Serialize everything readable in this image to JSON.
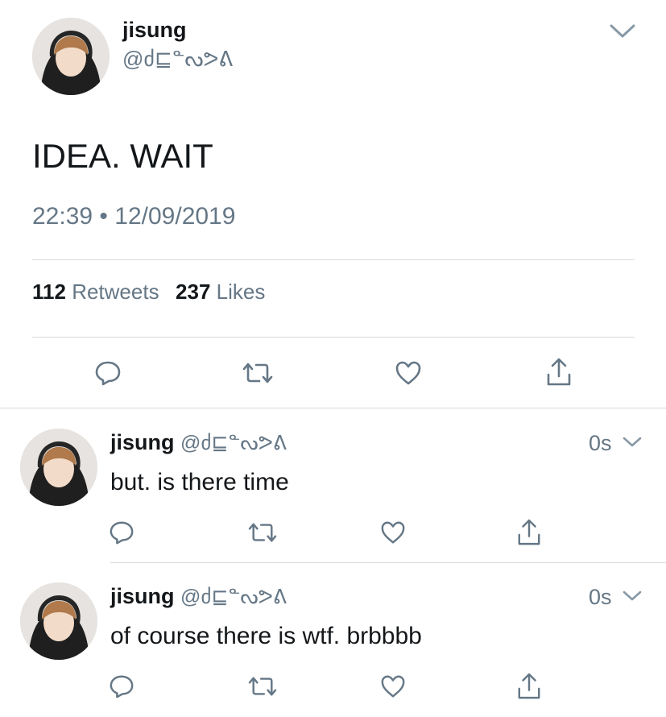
{
  "main_tweet": {
    "display_name": "jisung",
    "handle": "@ძ⊑ᓐᔓᕗᕕ",
    "text": "IDEA. WAIT",
    "time": "22:39",
    "dot": "•",
    "date": "12/09/2019",
    "retweets_count": "112",
    "retweets_label": "Retweets",
    "likes_count": "237",
    "likes_label": "Likes"
  },
  "replies": [
    {
      "display_name": "jisung",
      "handle": "@ძ⊑ᓐᔓᕗᕕ",
      "age": "0s",
      "text": "but. is there time"
    },
    {
      "display_name": "jisung",
      "handle": "@ძ⊑ᓐᔓᕗᕕ",
      "age": "0s",
      "text": "of course there is wtf. brbbbb"
    }
  ],
  "colors": {
    "text": "#14171a",
    "muted": "#657786",
    "separator": "#d6d9dc"
  }
}
